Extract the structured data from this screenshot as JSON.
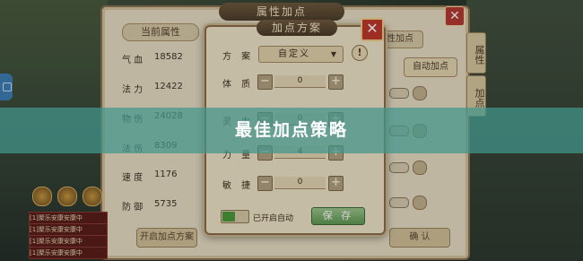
{
  "background_panel": {
    "title": "属性加点",
    "tab_current": "当前属性",
    "tab_right": "性加点",
    "auto_add_button": "自动加点",
    "attributes": [
      {
        "name": "气 血",
        "value": "18582"
      },
      {
        "name": "法 力",
        "value": "12422"
      },
      {
        "name": "物 伤",
        "value": "24028"
      },
      {
        "name": "法 伤",
        "value": "8309"
      },
      {
        "name": "速 度",
        "value": "1176"
      },
      {
        "name": "防 御",
        "value": "5735"
      }
    ],
    "bottom_left_button": "开启加点方案",
    "bottom_right_button": "确 认",
    "side_tabs": [
      "属性",
      "加点"
    ]
  },
  "pet_list": [
    "[1]聚乐安康安康中",
    "[1]聚乐安康安康中",
    "[1]聚乐安康安康中",
    "[1]聚乐安康安康中"
  ],
  "dialog": {
    "title": "加点方案",
    "scheme_label": "方 案",
    "scheme_value": "自定义",
    "rows": [
      {
        "label": "体 质",
        "value": "0"
      },
      {
        "label": "灵 力",
        "value": "0"
      },
      {
        "label": "力 量",
        "value": "4"
      },
      {
        "label": "敏 捷",
        "value": "0"
      }
    ],
    "auto_toggle_label": "已开启自动",
    "auto_toggle_on": true,
    "save_button": "保 存"
  },
  "banner": {
    "text": "最佳加点策略",
    "color": "#4296a0"
  },
  "icons": {
    "close": "close-icon",
    "warning": "exclamation-icon",
    "dropdown": "triangle-down-icon",
    "minus": "minus-icon",
    "plus": "plus-icon"
  }
}
